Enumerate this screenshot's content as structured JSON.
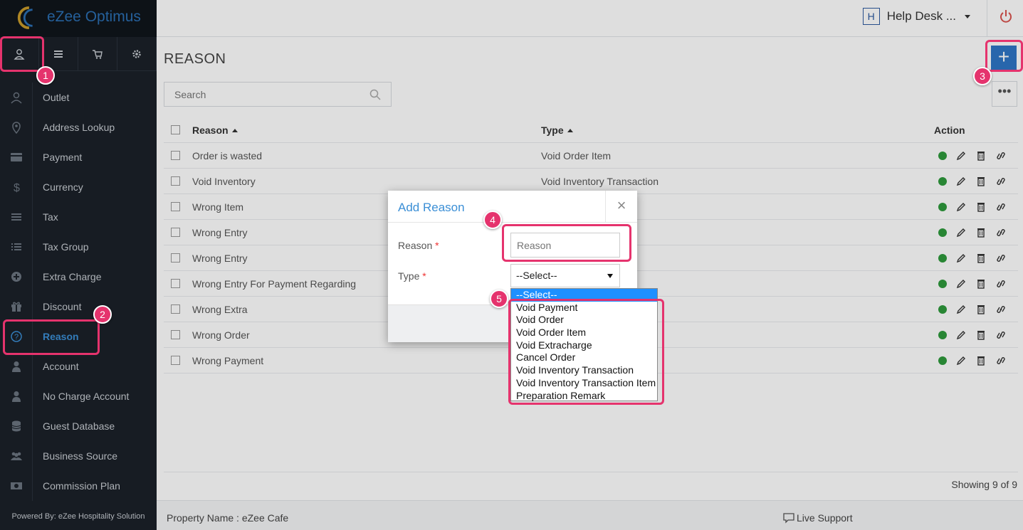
{
  "app": {
    "logo_text": "eZee Optimus",
    "powered_by": "Powered By: eZee Hospitality Solution"
  },
  "header": {
    "helpdesk_initial": "H",
    "helpdesk_label": "Help Desk ..."
  },
  "sidebar": {
    "top_icons": [
      "user-icon",
      "list-icon",
      "cart-icon",
      "gear-icon"
    ],
    "items": [
      {
        "label": "Outlet",
        "icon": "user-icon"
      },
      {
        "label": "Address Lookup",
        "icon": "map-pin-icon"
      },
      {
        "label": "Payment",
        "icon": "credit-card-icon"
      },
      {
        "label": "Currency",
        "icon": "dollar-icon"
      },
      {
        "label": "Tax",
        "icon": "menu-icon"
      },
      {
        "label": "Tax Group",
        "icon": "list-icon"
      },
      {
        "label": "Extra Charge",
        "icon": "plus-circle-icon"
      },
      {
        "label": "Discount",
        "icon": "gift-icon"
      },
      {
        "label": "Reason",
        "icon": "question-icon",
        "active": true
      },
      {
        "label": "Account",
        "icon": "person-icon"
      },
      {
        "label": "No Charge Account",
        "icon": "person-icon"
      },
      {
        "label": "Guest Database",
        "icon": "database-icon"
      },
      {
        "label": "Business Source",
        "icon": "group-icon"
      },
      {
        "label": "Commission Plan",
        "icon": "money-icon"
      }
    ]
  },
  "main": {
    "title": "REASON",
    "add_label": "+",
    "more_label": "•••",
    "search_placeholder": "Search",
    "columns": {
      "reason": "Reason",
      "type": "Type",
      "action": "Action"
    },
    "rows": [
      {
        "reason": "Order is wasted",
        "type": "Void Order Item"
      },
      {
        "reason": "Void Inventory",
        "type": "Void Inventory Transaction"
      },
      {
        "reason": "Wrong  Item",
        "type": ""
      },
      {
        "reason": "Wrong Entry",
        "type": ""
      },
      {
        "reason": "Wrong Entry",
        "type": ""
      },
      {
        "reason": "Wrong Entry For Payment Regarding",
        "type": ""
      },
      {
        "reason": "Wrong Extra",
        "type": ""
      },
      {
        "reason": "Wrong Order",
        "type": ""
      },
      {
        "reason": "Wrong Payment",
        "type": ""
      }
    ],
    "showing": "Showing 9 of 9"
  },
  "footer": {
    "property": "Property Name : eZee Cafe",
    "live_support": "Live Support"
  },
  "modal": {
    "title": "Add Reason",
    "close": "×",
    "reason_label": "Reason",
    "reason_placeholder": "Reason",
    "type_label": "Type",
    "required_mark": "*",
    "type_selected": "--Select--"
  },
  "dropdown": {
    "options": [
      "--Select--",
      "Void Payment",
      "Void Order",
      "Void Order Item",
      "Void Extracharge",
      "Cancel Order",
      "Void Inventory Transaction",
      "Void Inventory Transaction Item",
      "Preparation Remark"
    ]
  },
  "callouts": [
    "1",
    "2",
    "3",
    "4",
    "5"
  ],
  "colors": {
    "accent": "#2f76c6",
    "highlight": "#e5336d",
    "status_dot": "#2e9a3c",
    "sidebar_bg": "#1b2129"
  }
}
